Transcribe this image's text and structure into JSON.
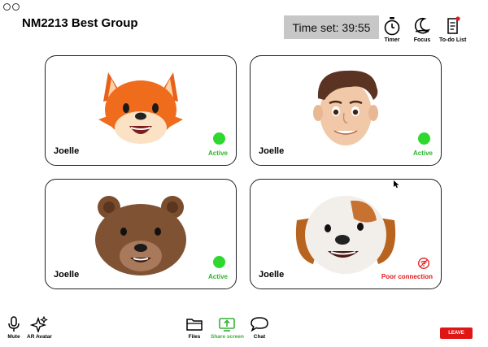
{
  "header": {
    "title": "NM2213 Best Group",
    "timer_text": "Time set: 39:55"
  },
  "tools": {
    "timer": "Timer",
    "focus": "Focus",
    "todo": "To-do List"
  },
  "participants": [
    {
      "name": "Joelle",
      "status": "Active",
      "avatar": "fox-avatar"
    },
    {
      "name": "Joelle",
      "status": "Active",
      "avatar": "boy-avatar"
    },
    {
      "name": "Joelle",
      "status": "Active",
      "avatar": "bear-avatar"
    },
    {
      "name": "Joelle",
      "status": "Poor connection",
      "avatar": "dog-avatar"
    }
  ],
  "controls": {
    "mute": "Mute",
    "ar_avatar": "AR Avatar",
    "files": "Files",
    "share_screen": "Share screen",
    "chat": "Chat",
    "leave": "LEAVE"
  },
  "colors": {
    "active": "#2bb52b",
    "poor": "#e11b1b",
    "leave": "#e01616",
    "timer_bg": "#c7c7c7"
  }
}
